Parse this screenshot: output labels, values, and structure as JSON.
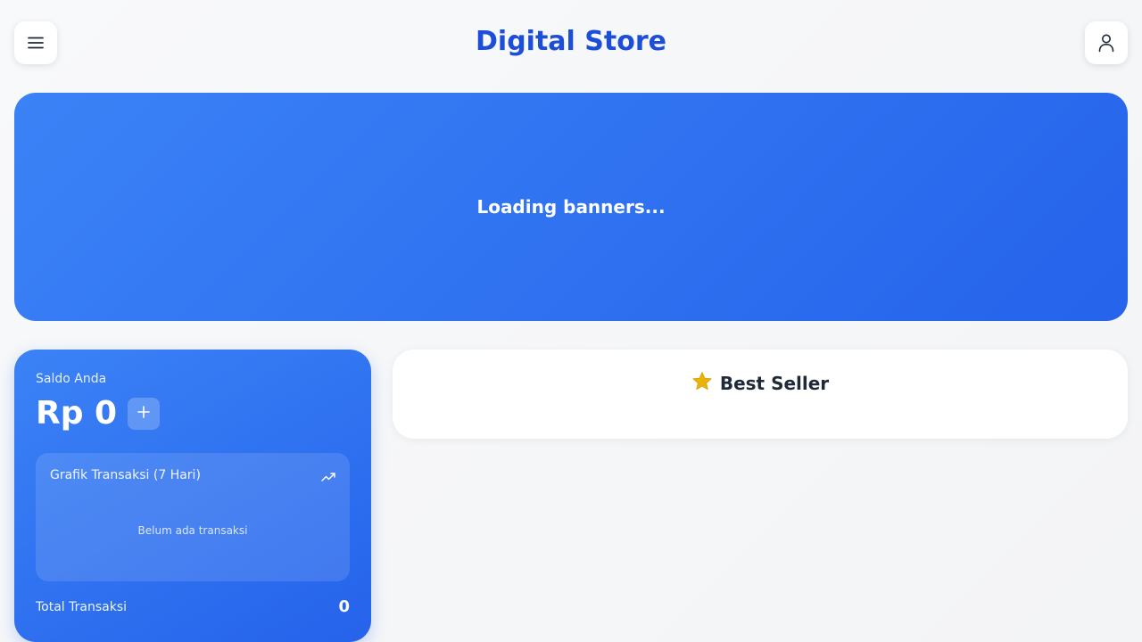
{
  "header": {
    "title": "Digital Store",
    "menu_icon": "menu-icon",
    "user_icon": "user-icon",
    "accent_color": "#1d4ed8"
  },
  "banner": {
    "loading_text": "Loading banners...",
    "color": "#3b82f6"
  },
  "balance": {
    "label": "Saldo Anda",
    "amount": "Rp 0",
    "topup_icon": "plus-icon",
    "chart": {
      "title": "Grafik Transaksi (7 Hari)",
      "icon": "trending-up-icon",
      "empty_text": "Belum ada transaksi"
    },
    "total_label": "Total Transaksi",
    "total_value": "0"
  },
  "best_seller": {
    "title": "Best Seller",
    "icon": "star-icon",
    "icon_color": "#eab308"
  }
}
